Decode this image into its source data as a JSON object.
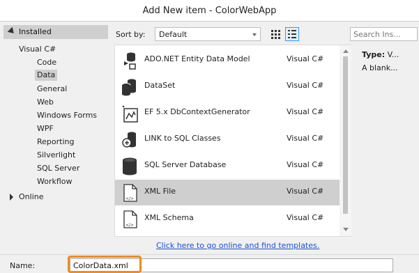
{
  "window": {
    "title": "Add New item - ColorWebApp"
  },
  "left_pane": {
    "installed_label": "Installed",
    "group_label": "Visual C#",
    "categories": [
      "Code",
      "Data",
      "General",
      "Web",
      "Windows Forms",
      "WPF",
      "Reporting",
      "Silverlight",
      "SQL Server",
      "Workflow"
    ],
    "selected_category": "Data",
    "online_label": "Online"
  },
  "toolbar": {
    "sort_label": "Sort by:",
    "sort_value": "Default",
    "search_placeholder": "Search Ins..."
  },
  "items": [
    {
      "name": "ADO.NET Entity Data Model",
      "lang": "Visual C#",
      "icon": "entity-model-icon"
    },
    {
      "name": "DataSet",
      "lang": "Visual C#",
      "icon": "dataset-icon"
    },
    {
      "name": "EF 5.x DbContextGenerator",
      "lang": "Visual C#",
      "icon": "dbcontext-generator-icon"
    },
    {
      "name": "LINK to SQL Classes",
      "lang": "Visual C#",
      "icon": "linq-classes-icon"
    },
    {
      "name": "SQL Server Database",
      "lang": "Visual C#",
      "icon": "database-icon"
    },
    {
      "name": "XML File",
      "lang": "Visual C#",
      "icon": "xml-file-icon"
    },
    {
      "name": "XML Schema",
      "lang": "Visual C#",
      "icon": "xml-schema-icon"
    }
  ],
  "selected_item": "XML File",
  "details": {
    "type_label": "Type:",
    "type_value": "V...",
    "description": "A blank..."
  },
  "online_link": "Click here to go online and find templates.",
  "name_field": {
    "label": "Name:",
    "value": "ColorData.xml"
  },
  "colors": {
    "highlight": "#f28a1c",
    "link": "#1a4fd6",
    "selection": "#cfcfcf"
  }
}
